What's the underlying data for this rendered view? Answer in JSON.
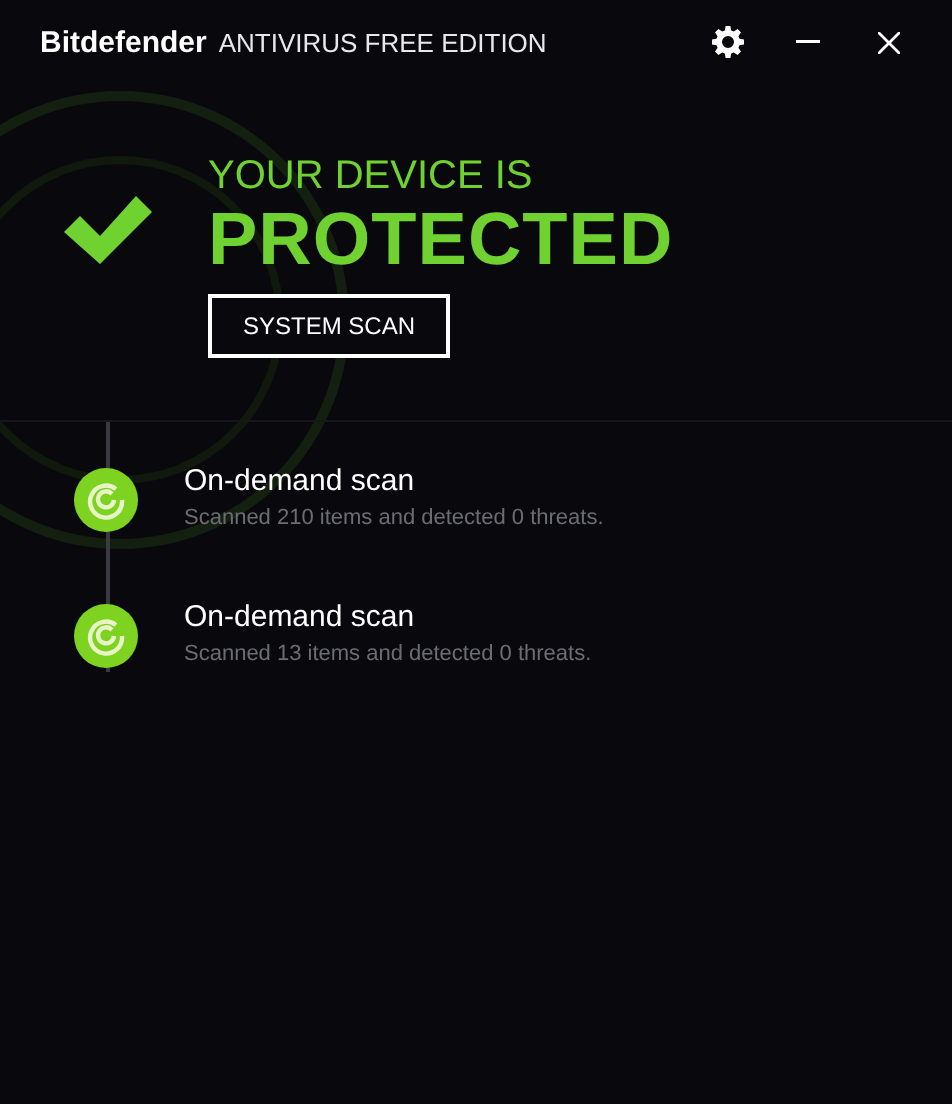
{
  "window": {
    "brand": "Bitdefender",
    "title": "ANTIVIRUS FREE EDITION"
  },
  "status": {
    "line1": "YOUR DEVICE IS",
    "line2": "PROTECTED",
    "protected": true
  },
  "scan_button": "SYSTEM SCAN",
  "events": [
    {
      "title": "On-demand scan",
      "detail": "Scanned 210 items and detected 0 threats."
    },
    {
      "title": "On-demand scan",
      "detail": "Scanned 13 items and detected 0 threats."
    }
  ]
}
